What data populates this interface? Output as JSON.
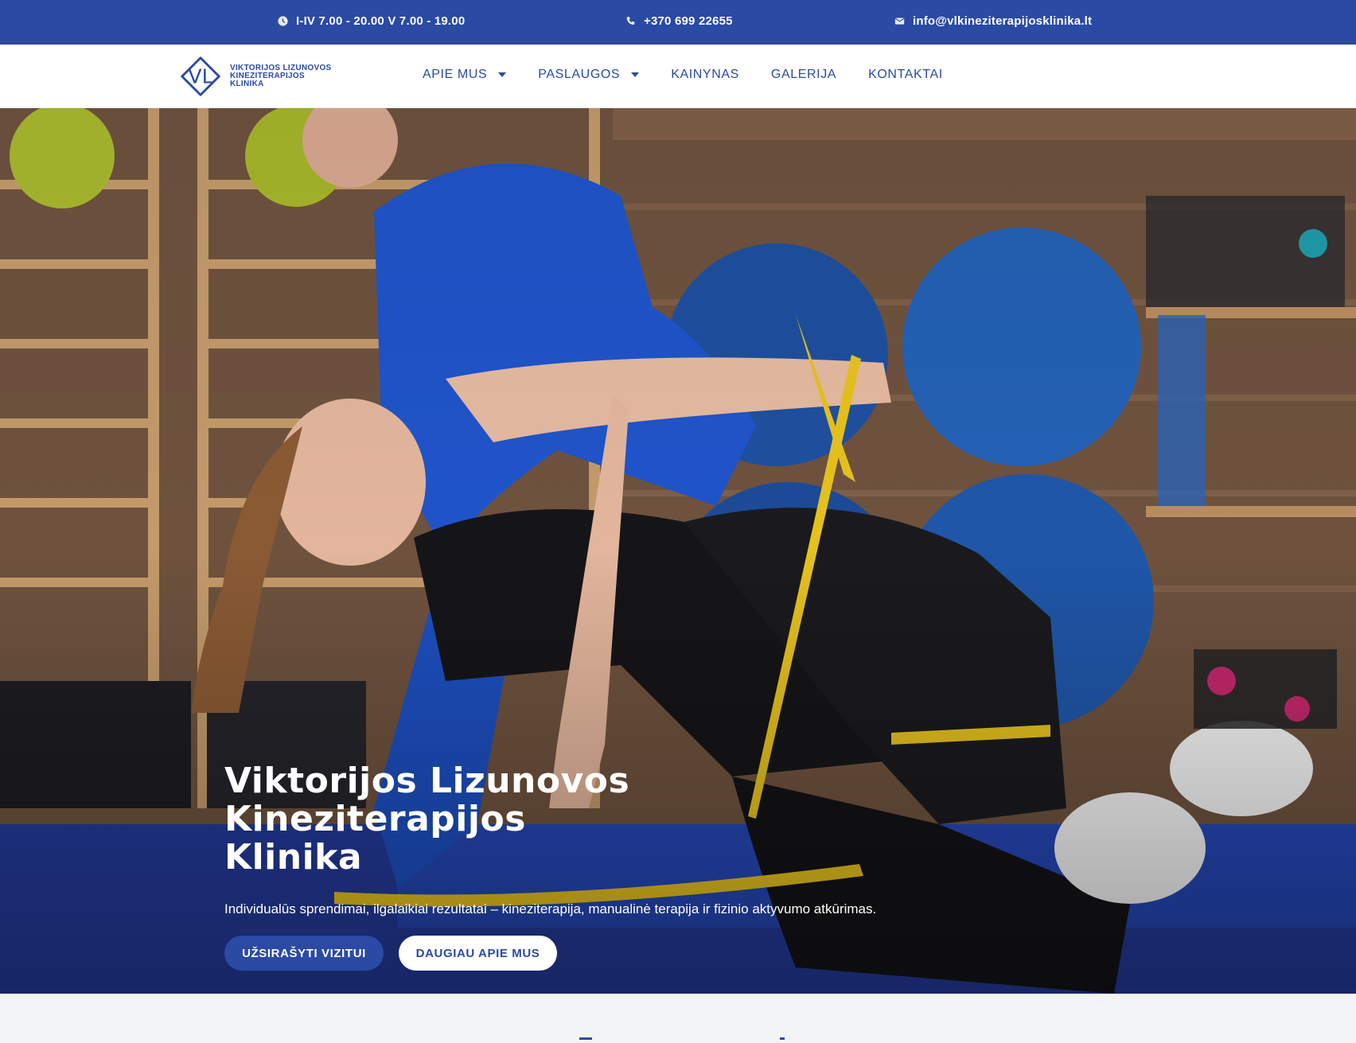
{
  "topbar": {
    "hours": "I-IV 7.00 - 20.00 V 7.00 - 19.00",
    "phone": "+370 699 22655",
    "email": "info@vlkineziterapijosklinika.lt",
    "icons": [
      "clock-icon",
      "phone-icon",
      "mail-icon"
    ]
  },
  "logo": {
    "mark": "VL",
    "line1": "VIKTORIJOS LIZUNOVOS",
    "line2": "KINEZITERAPIJOS",
    "line3": "KLINIKA"
  },
  "nav": {
    "items": [
      {
        "label": "APIE MUS",
        "has_dropdown": true
      },
      {
        "label": "PASLAUGOS",
        "has_dropdown": true
      },
      {
        "label": "KAINYNAS",
        "has_dropdown": false
      },
      {
        "label": "GALERIJA",
        "has_dropdown": false
      },
      {
        "label": "KONTAKTAI",
        "has_dropdown": false
      }
    ]
  },
  "hero": {
    "title_line1": "Viktorijos Lizunovos",
    "title_line2": "Kineziterapijos",
    "title_line3": "Klinika",
    "subtitle": "Individualūs sprendimai, ilgalaikiai rezultatai – kineziterapija, manualinė terapija ir fizinio aktyvumo atkūrimas.",
    "primary_button": "UŽSIRAŠYTI VIZITUI",
    "secondary_button": "DAUGIAU APIE MUS"
  },
  "colors": {
    "brand": "#2a4aa3",
    "white": "#ffffff",
    "background": "#f3f4f6"
  }
}
